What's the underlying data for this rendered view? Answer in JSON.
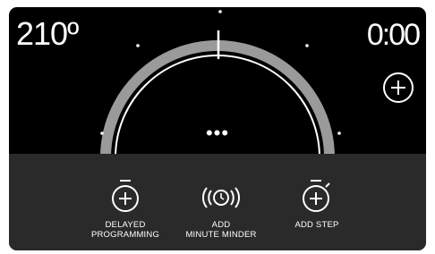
{
  "display": {
    "temperature": "210º",
    "timer": "0:00"
  },
  "menu": {
    "dots": "•••"
  },
  "actions": [
    {
      "label": "DELAYED\nPROGRAMMING",
      "icon": "stopwatch-plus-icon"
    },
    {
      "label": "ADD\nMINUTE MINDER",
      "icon": "alarm-clock-icon"
    },
    {
      "label": "ADD STEP",
      "icon": "stopwatch-step-icon"
    }
  ],
  "colors": {
    "background": "#000000",
    "panel": "#2a2a2a",
    "ring": "#9a9a9a",
    "text": "#ffffff"
  }
}
